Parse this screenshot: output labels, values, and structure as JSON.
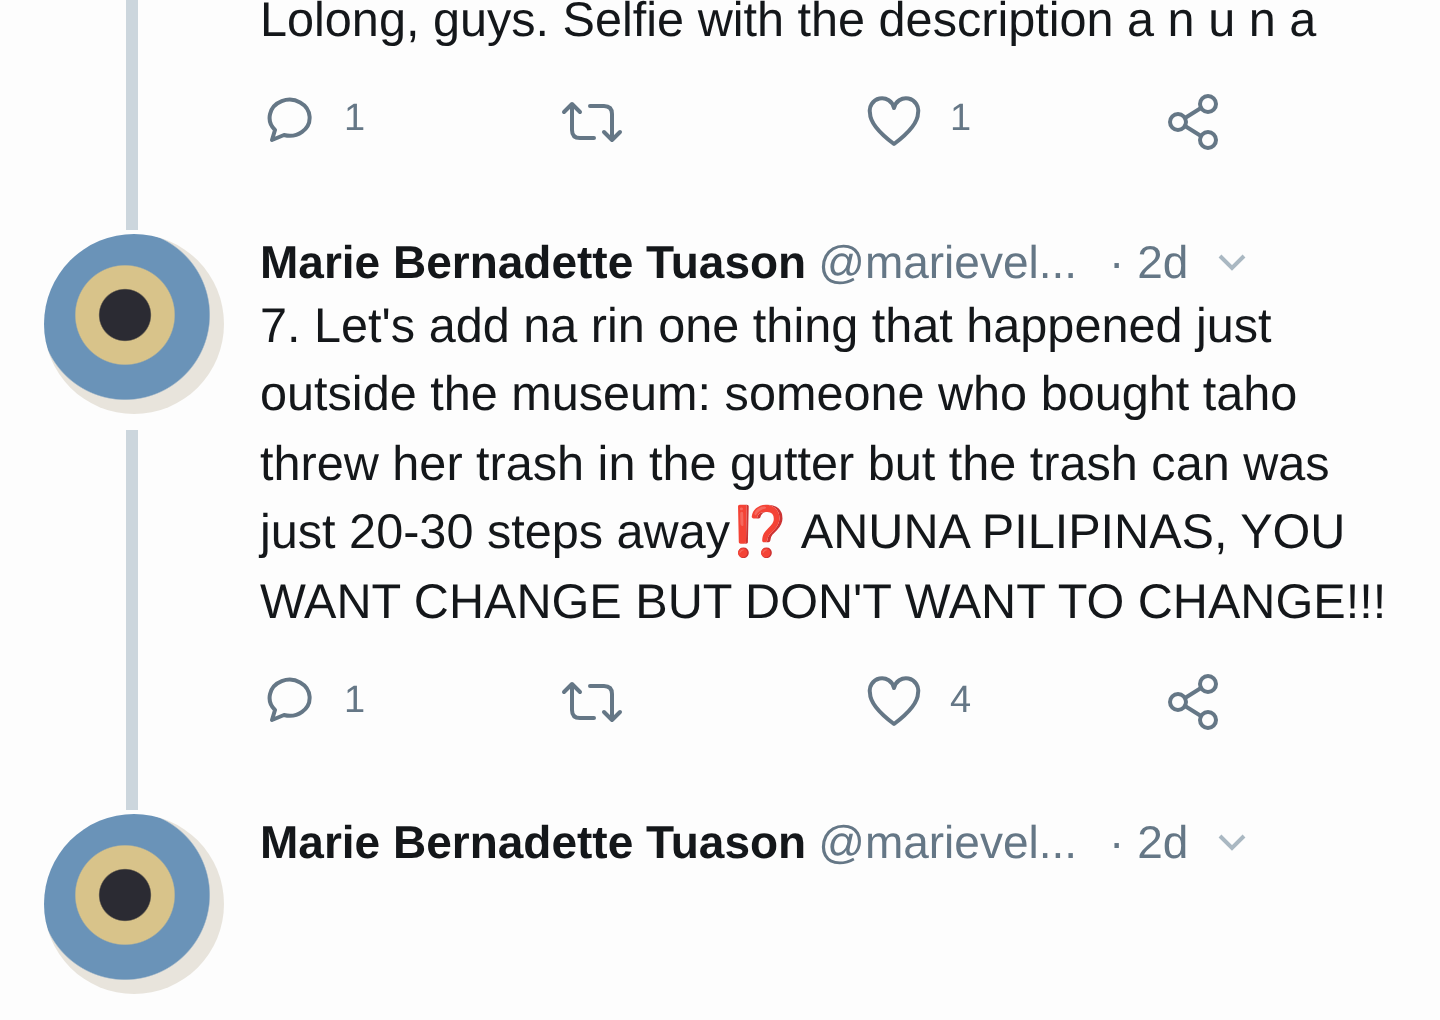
{
  "tweets": [
    {
      "text": "Lolong, guys. Selfie with the description a n u n a",
      "actions": {
        "replies": "1",
        "likes": "1"
      }
    },
    {
      "name": "Marie Bernadette Tuason",
      "handle": "@marievel...",
      "time": "· 2d",
      "text": "7. Let's add na rin one thing that happened just outside the museum: someone who bought taho threw her trash in the gutter but the trash can was just 20-30 steps away⁉️ ANUNA PILIPINAS, YOU WANT CHANGE BUT DON'T WANT TO CHANGE!!!",
      "actions": {
        "replies": "1",
        "likes": "4"
      }
    },
    {
      "name": "Marie Bernadette Tuason",
      "handle": "@marievel...",
      "time": "· 2d"
    }
  ]
}
